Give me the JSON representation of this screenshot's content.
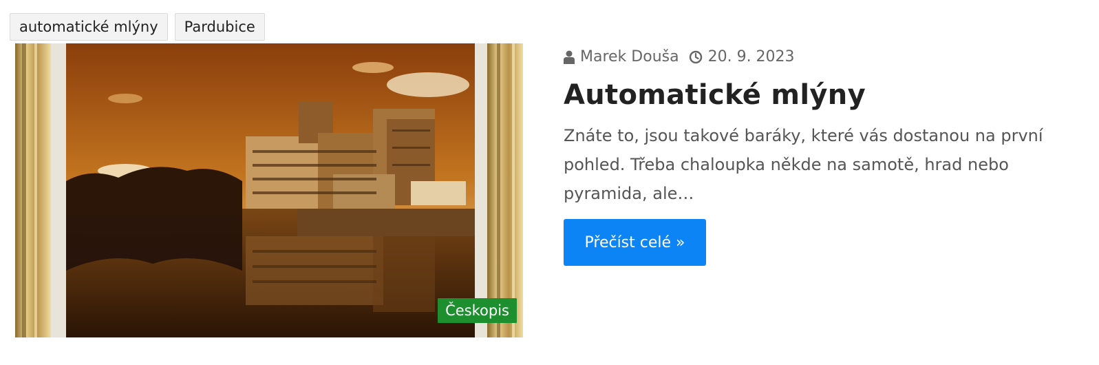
{
  "tags": [
    {
      "label": "automatické mlýny"
    },
    {
      "label": "Pardubice"
    }
  ],
  "post": {
    "category": "Českopis",
    "author": "Marek Douša",
    "date": "20. 9. 2023",
    "title": "Automatické mlýny",
    "excerpt": "Znáte to, jsou takové baráky, které vás dostanou na první pohled. Třeba chaloupka někde na samotě, hrad nebo pyramida, ale…",
    "read_more": "Přečíst celé »"
  },
  "icons": {
    "author": "user-icon",
    "date": "clock-icon"
  },
  "colors": {
    "badge": "#1e8f2e",
    "button": "#0d84f5",
    "title": "#222222",
    "text": "#555555"
  }
}
